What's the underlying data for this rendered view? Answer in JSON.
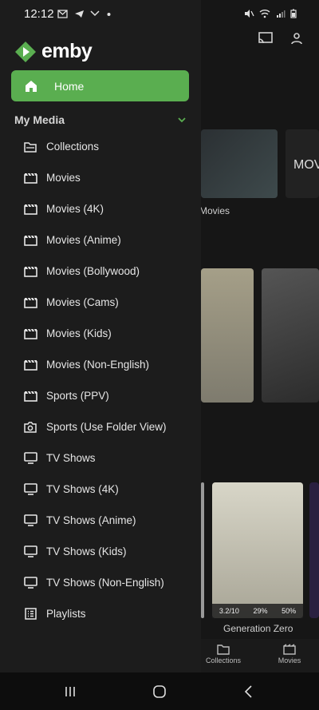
{
  "status_bar": {
    "time": "12:12",
    "notification_icons": [
      "mail-icon",
      "telegram-icon",
      "missed-call-icon",
      "dot"
    ],
    "system_icons": [
      "mute-icon",
      "wifi-icon",
      "signal-icon",
      "battery-icon"
    ]
  },
  "drawer": {
    "logo_text": "emby",
    "home_label": "Home",
    "section_title": "My Media",
    "items": [
      {
        "label": "Collections",
        "icon": "folder-icon"
      },
      {
        "label": "Movies",
        "icon": "film-icon"
      },
      {
        "label": "Movies (4K)",
        "icon": "film-icon"
      },
      {
        "label": "Movies (Anime)",
        "icon": "film-icon"
      },
      {
        "label": "Movies (Bollywood)",
        "icon": "film-icon"
      },
      {
        "label": "Movies (Cams)",
        "icon": "film-icon"
      },
      {
        "label": "Movies (Kids)",
        "icon": "film-icon"
      },
      {
        "label": "Movies (Non-English)",
        "icon": "film-icon"
      },
      {
        "label": "Sports (PPV)",
        "icon": "film-icon"
      },
      {
        "label": "Sports (Use Folder View)",
        "icon": "camera-icon"
      },
      {
        "label": "TV Shows",
        "icon": "tv-icon"
      },
      {
        "label": "TV Shows (4K)",
        "icon": "tv-icon"
      },
      {
        "label": "TV Shows (Anime)",
        "icon": "tv-icon"
      },
      {
        "label": "TV Shows (Kids)",
        "icon": "tv-icon"
      },
      {
        "label": "TV Shows (Non-English)",
        "icon": "tv-icon"
      },
      {
        "label": "Playlists",
        "icon": "playlist-icon"
      }
    ]
  },
  "background": {
    "tile_label_movies": "Movies",
    "partial_text": "MOV",
    "card_title": "Generation Zero",
    "card_rating": "3.2/10",
    "card_score_a": "29%",
    "card_score_b": "50%",
    "bottom_nav": [
      "Collections",
      "Movies"
    ]
  },
  "colors": {
    "accent": "#5aae50",
    "drawer_bg": "#1c1c1c",
    "background": "#161616"
  }
}
